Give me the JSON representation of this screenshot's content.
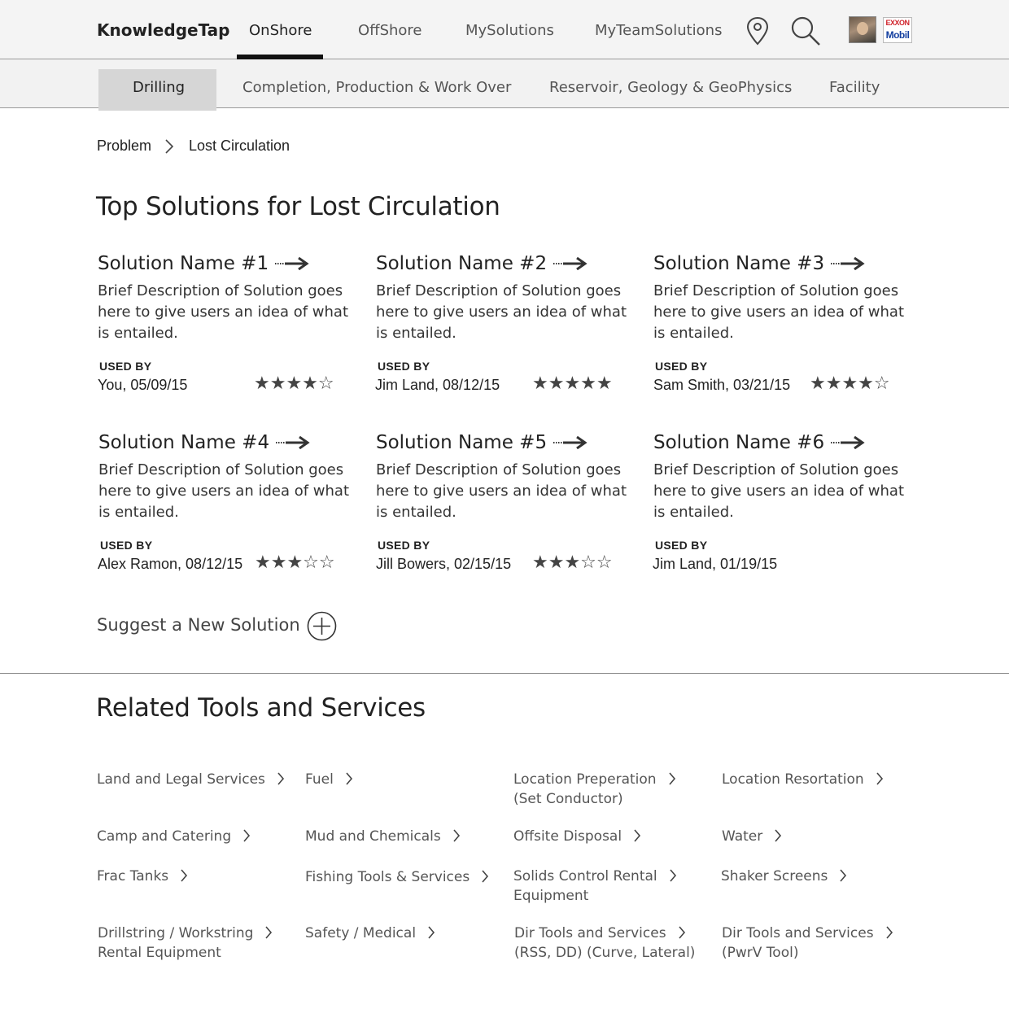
{
  "header": {
    "brand": "KnowledgeTap",
    "tabs": [
      {
        "label": "OnShore",
        "active": true
      },
      {
        "label": "OffShore"
      },
      {
        "label": "MySolutions"
      },
      {
        "label": "MyTeamSolutions"
      }
    ],
    "icons": [
      "location-pin-icon",
      "search-icon",
      "user-avatar",
      "exxonmobil-logo"
    ],
    "logo_text": [
      "EXXON",
      "Mobil"
    ]
  },
  "subnav": {
    "items": [
      {
        "label": "Drilling",
        "active": true
      },
      {
        "label": "Completion, Production & Work Over"
      },
      {
        "label": "Reservoir, Geology & GeoPhysics"
      },
      {
        "label": "Facility"
      }
    ]
  },
  "breadcrumb": [
    "Problem",
    "Lost Circulation"
  ],
  "solutions": {
    "heading": "Top Solutions for Lost Circulation",
    "used_by_label": "USED BY",
    "items": [
      {
        "name": "Solution Name #1",
        "description": "Brief Description of Solution goes here to give users an idea of what is entailed.",
        "user": "You, 05/09/15",
        "rating": 4,
        "stars": "★★★★☆"
      },
      {
        "name": "Solution Name #2",
        "description": "Brief Description of Solution goes here to give users an idea of what is entailed.",
        "user": "Jim Land, 08/12/15",
        "rating": 5,
        "stars": "★★★★★"
      },
      {
        "name": "Solution Name #3",
        "description": "Brief Description of Solution goes here to give users an idea of what is entailed.",
        "user": "Sam Smith, 03/21/15",
        "rating": 4,
        "stars": "★★★★☆"
      },
      {
        "name": "Solution Name #4",
        "description": "Brief Description of Solution goes here to give users an idea of what is entailed.",
        "user": "Alex Ramon, 08/12/15",
        "rating": 3,
        "stars": "★★★☆☆"
      },
      {
        "name": "Solution Name #5",
        "description": "Brief Description of Solution goes here to give users an idea of what is entailed.",
        "user": "Jill Bowers, 02/15/15",
        "rating": 3,
        "stars": "★★★☆☆"
      },
      {
        "name": "Solution Name #6",
        "description": "Brief Description of Solution goes here to give users an idea of what is entailed.",
        "user": "Jim Land, 01/19/15",
        "rating": null,
        "stars": ""
      }
    ],
    "suggest_label": "Suggest a New Solution"
  },
  "related": {
    "heading": "Related Tools and Services",
    "items": [
      {
        "line1": "Land and Legal Services",
        "line2": ""
      },
      {
        "line1": "Fuel",
        "line2": ""
      },
      {
        "line1": "Location Preperation",
        "line2": "(Set Conductor)"
      },
      {
        "line1": "Location Resortation",
        "line2": ""
      },
      {
        "line1": "Camp and Catering",
        "line2": ""
      },
      {
        "line1": "Mud and Chemicals",
        "line2": ""
      },
      {
        "line1": "Offsite Disposal",
        "line2": ""
      },
      {
        "line1": "Water",
        "line2": ""
      },
      {
        "line1": "Frac Tanks",
        "line2": ""
      },
      {
        "line1": "Fishing Tools & Services",
        "line2": ""
      },
      {
        "line1": "Solids Control Rental",
        "line2": "Equipment"
      },
      {
        "line1": "Shaker Screens",
        "line2": ""
      },
      {
        "line1": "Drillstring / Workstring",
        "line2": "Rental Equipment"
      },
      {
        "line1": "Safety / Medical",
        "line2": ""
      },
      {
        "line1": "Dir Tools and Services",
        "line2": "(RSS, DD) (Curve, Lateral)"
      },
      {
        "line1": "Dir Tools and Services",
        "line2": "(PwrV Tool)"
      }
    ]
  }
}
